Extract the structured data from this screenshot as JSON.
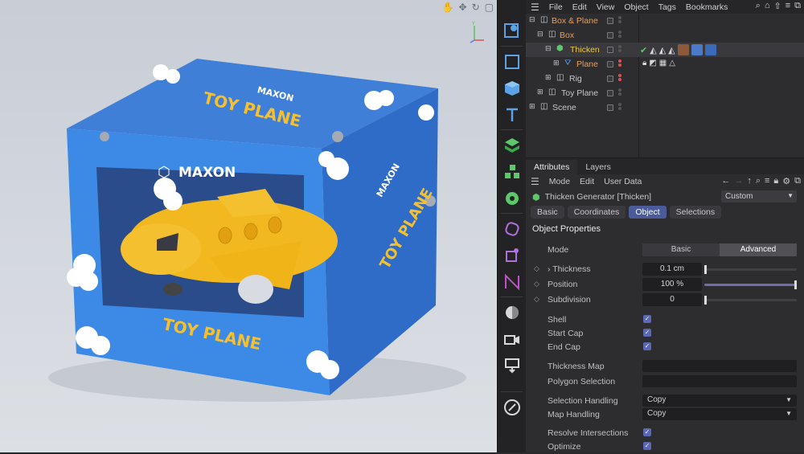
{
  "object_manager": {
    "menu": [
      "File",
      "Edit",
      "View",
      "Object",
      "Tags",
      "Bookmarks"
    ],
    "tree": [
      {
        "name": "Box & Plane",
        "color": "#e8a060",
        "indent": 0
      },
      {
        "name": "Box",
        "color": "#e8a060",
        "indent": 1
      },
      {
        "name": "Thicken",
        "color": "#e8c84a",
        "indent": 2
      },
      {
        "name": "Plane",
        "color": "#e8a060",
        "indent": 3
      },
      {
        "name": "Rig",
        "color": "#c8c8cc",
        "indent": 2
      },
      {
        "name": "Toy Plane",
        "color": "#c8c8cc",
        "indent": 1
      },
      {
        "name": "Scene",
        "color": "#c8c8cc",
        "indent": 0
      }
    ]
  },
  "attributes": {
    "tabs": [
      "Attributes",
      "Layers"
    ],
    "menu": [
      "Mode",
      "Edit",
      "User Data"
    ],
    "object_title": "Thicken Generator [Thicken]",
    "preset": "Custom",
    "subtabs": [
      "Basic",
      "Coordinates",
      "Object",
      "Selections"
    ],
    "active_subtab": "Object",
    "section": "Object Properties",
    "mode_label": "Mode",
    "mode_options": [
      "Basic",
      "Advanced"
    ],
    "thickness_label": "Thickness",
    "thickness_value": "0.1 cm",
    "position_label": "Position",
    "position_value": "100 %",
    "position_fraction": 1.0,
    "subdivision_label": "Subdivision",
    "subdivision_value": "0",
    "shell_label": "Shell",
    "start_cap_label": "Start Cap",
    "end_cap_label": "End Cap",
    "thickness_map_label": "Thickness Map",
    "polygon_selection_label": "Polygon Selection",
    "selection_handling_label": "Selection Handling",
    "selection_handling_value": "Copy",
    "map_handling_label": "Map Handling",
    "map_handling_value": "Copy",
    "resolve_label": "Resolve Intersections",
    "optimize_label": "Optimize"
  },
  "viewport": {
    "box_brand": "MAXON",
    "box_text_top": "TOY PLANE",
    "box_text_front": "TOY PLANE",
    "box_text_side": "TOY PLANE"
  }
}
